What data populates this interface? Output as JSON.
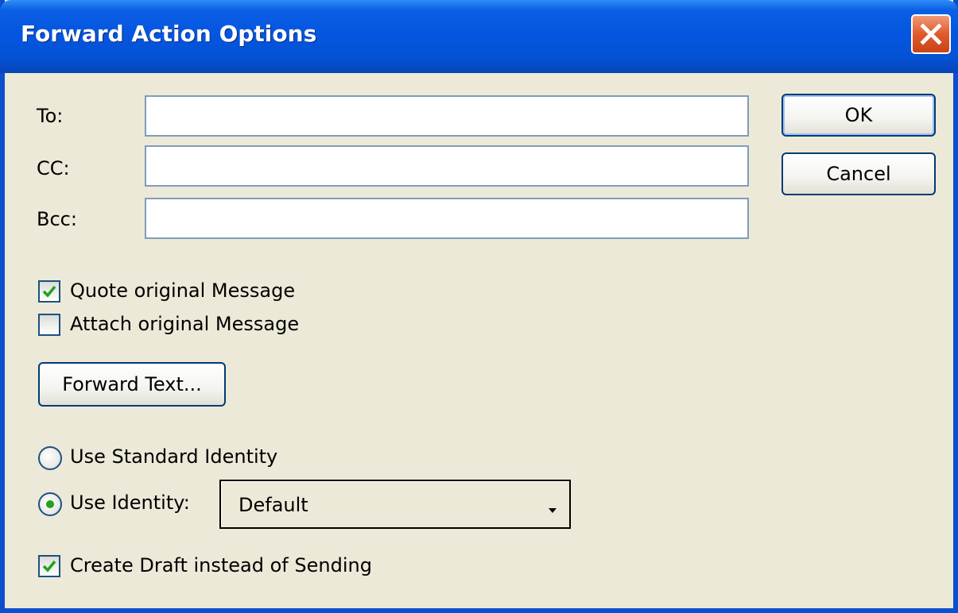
{
  "window": {
    "title": "Forward Action Options"
  },
  "fields": {
    "to_label": "To:",
    "to_value": "",
    "cc_label": "CC:",
    "cc_value": "",
    "bcc_label": "Bcc:",
    "bcc_value": ""
  },
  "buttons": {
    "ok": "OK",
    "cancel": "Cancel",
    "forward_text": "Forward Text..."
  },
  "options": {
    "quote_original": {
      "label": "Quote original Message",
      "checked": true
    },
    "attach_original": {
      "label": "Attach original Message",
      "checked": false
    },
    "use_standard_identity": {
      "label": "Use Standard Identity",
      "selected": false
    },
    "use_identity": {
      "label": "Use Identity:",
      "selected": true
    },
    "create_draft": {
      "label": "Create Draft instead of Sending",
      "checked": true
    }
  },
  "identity_select": {
    "value": "Default"
  },
  "icons": {
    "close": "close-icon",
    "check": "checkmark-icon",
    "dropdown": "chevron-down-icon"
  },
  "colors": {
    "titlebar": "#0556e0",
    "dialog_bg": "#ece9d8",
    "close_button": "#e05a2a",
    "check_green": "#21a121"
  }
}
